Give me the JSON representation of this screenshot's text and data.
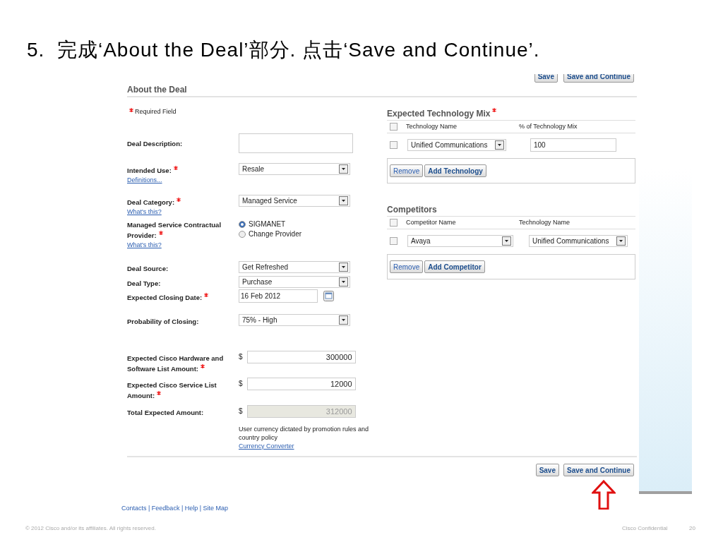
{
  "slide_title": "5.  完成‘About the Deal’部分. 点击‘Save and Continue’.",
  "top_buttons": [
    "Save",
    "Save and Continue"
  ],
  "form": {
    "heading": "About the Deal",
    "required_note": "Required Field",
    "fields": [
      {
        "kind": "textarea",
        "label": "Deal Description:",
        "required": false
      },
      {
        "kind": "select",
        "label": "Intended Use:",
        "required": true,
        "link": "Definitions...",
        "value": "Resale"
      },
      {
        "kind": "select",
        "label": "Deal Category:",
        "required": true,
        "link": "What's this?",
        "value": "Managed Service"
      },
      {
        "kind": "radio",
        "label": "Managed Service Contractual Provider:",
        "required": true,
        "link": "What's this?",
        "options": [
          {
            "label": "SIGMANET",
            "selected": true
          },
          {
            "label": "Change Provider",
            "selected": false
          }
        ]
      },
      {
        "kind": "select",
        "label": "Deal Source:",
        "required": false,
        "value": "Get Refreshed"
      },
      {
        "kind": "select",
        "label": "Deal Type:",
        "required": false,
        "value": "Purchase"
      },
      {
        "kind": "date",
        "label": "Expected Closing Date:",
        "required": true,
        "value": "16 Feb 2012"
      },
      {
        "kind": "select",
        "label": "Probability of Closing:",
        "required": false,
        "value": "75% - High"
      },
      {
        "kind": "amount",
        "label": "Expected Cisco Hardware and Software List Amount:",
        "required": true,
        "currency": "$",
        "value": "300000",
        "disabled": false
      },
      {
        "kind": "amount",
        "label": "Expected Cisco Service List Amount:",
        "required": true,
        "currency": "$",
        "value": "12000",
        "disabled": false
      },
      {
        "kind": "amount",
        "label": "Total Expected Amount:",
        "required": false,
        "currency": "$",
        "value": "312000",
        "disabled": true
      }
    ],
    "currency_note": "User currency dictated by promotion rules and country policy",
    "currency_link": "Currency Converter"
  },
  "tech_mix": {
    "title": "Expected Technology Mix",
    "required": true,
    "header_checked": false,
    "columns": [
      "Technology Name",
      "% of Technology Mix"
    ],
    "rows": [
      {
        "checked": false,
        "technology": "Unified Communications",
        "percent": "100"
      }
    ],
    "buttons": [
      "Remove",
      "Add Technology"
    ]
  },
  "competitors": {
    "title": "Competitors",
    "header_checked": false,
    "columns": [
      "Competitor Name",
      "Technology Name"
    ],
    "rows": [
      {
        "checked": false,
        "competitor": "Avaya",
        "technology": "Unified Communications"
      }
    ],
    "buttons": [
      "Remove",
      "Add Competitor"
    ]
  },
  "bottom_buttons": [
    "Save",
    "Save and Continue"
  ],
  "footer_links": "Contacts | Feedback | Help | Site Map",
  "copyright": "© 2012 Cisco and/or its affiliates. All rights reserved.",
  "confidential": "Cisco Confidential",
  "page_number": "20"
}
